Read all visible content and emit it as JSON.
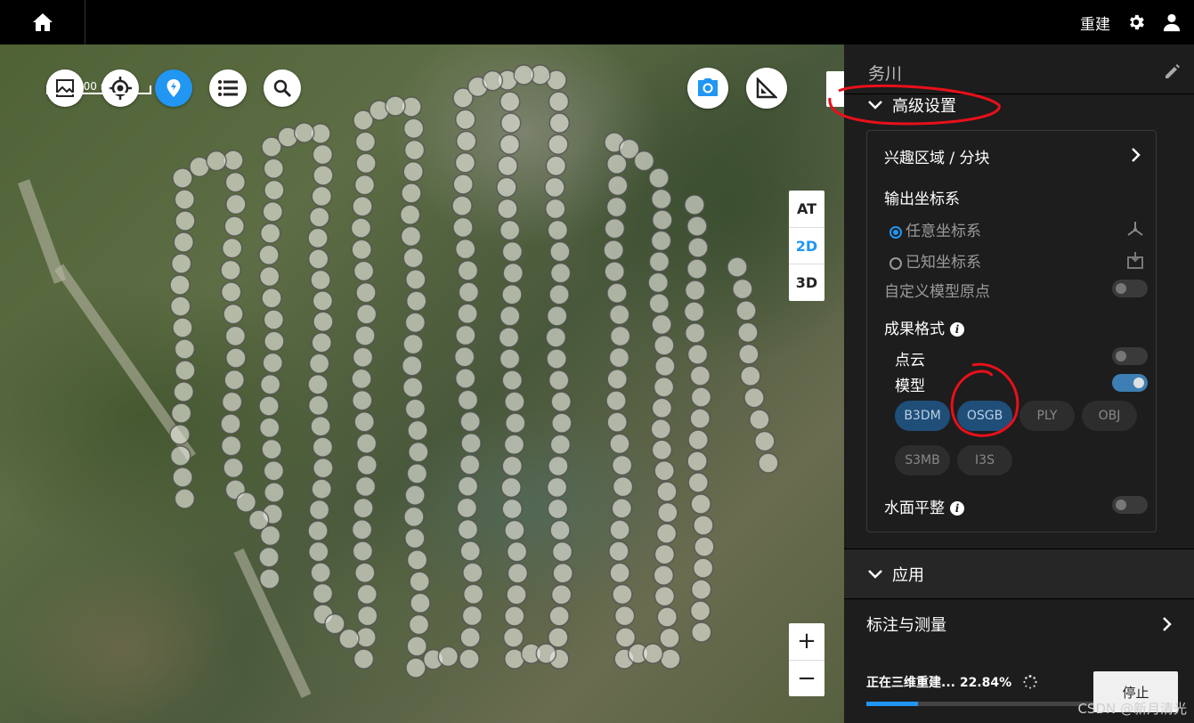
{
  "topbar": {
    "rebuild_label": "重建"
  },
  "map": {
    "scale_label": "100 m"
  },
  "view_modes": {
    "at": "AT",
    "d2": "2D",
    "d3": "3D",
    "selected": "2D"
  },
  "zoom": {
    "in": "+",
    "out": "−"
  },
  "panel": {
    "title": "务川",
    "advanced": {
      "header": "高级设置",
      "roi_label": "兴趣区域 / 分块",
      "output_crs_label": "输出坐标系",
      "crs_options": [
        {
          "label": "任意坐标系",
          "selected": true
        },
        {
          "label": "已知坐标系",
          "selected": false
        }
      ],
      "custom_origin_label": "自定义模型原点",
      "custom_origin_enabled": false,
      "output_format_label": "成果格式",
      "point_cloud_label": "点云",
      "point_cloud_enabled": false,
      "model_label": "模型",
      "model_enabled": true,
      "formats": [
        {
          "label": "B3DM",
          "selected": true
        },
        {
          "label": "OSGB",
          "selected": true
        },
        {
          "label": "PLY",
          "selected": false
        },
        {
          "label": "OBJ",
          "selected": false
        },
        {
          "label": "S3MB",
          "selected": false
        },
        {
          "label": "I3S",
          "selected": false
        }
      ],
      "water_flatten_label": "水面平整",
      "water_flatten_enabled": false
    },
    "apply_header": "应用",
    "measure_label": "标注与测量",
    "status": {
      "text": "正在三维重建... 22.84%",
      "progress": 0.2284
    },
    "stop_label": "停止"
  },
  "watermark": "CSDN @新月清光",
  "colors": {
    "accent": "#2196f3",
    "panel_bg": "#1d1d1d",
    "annotation_red": "#e8101a"
  }
}
